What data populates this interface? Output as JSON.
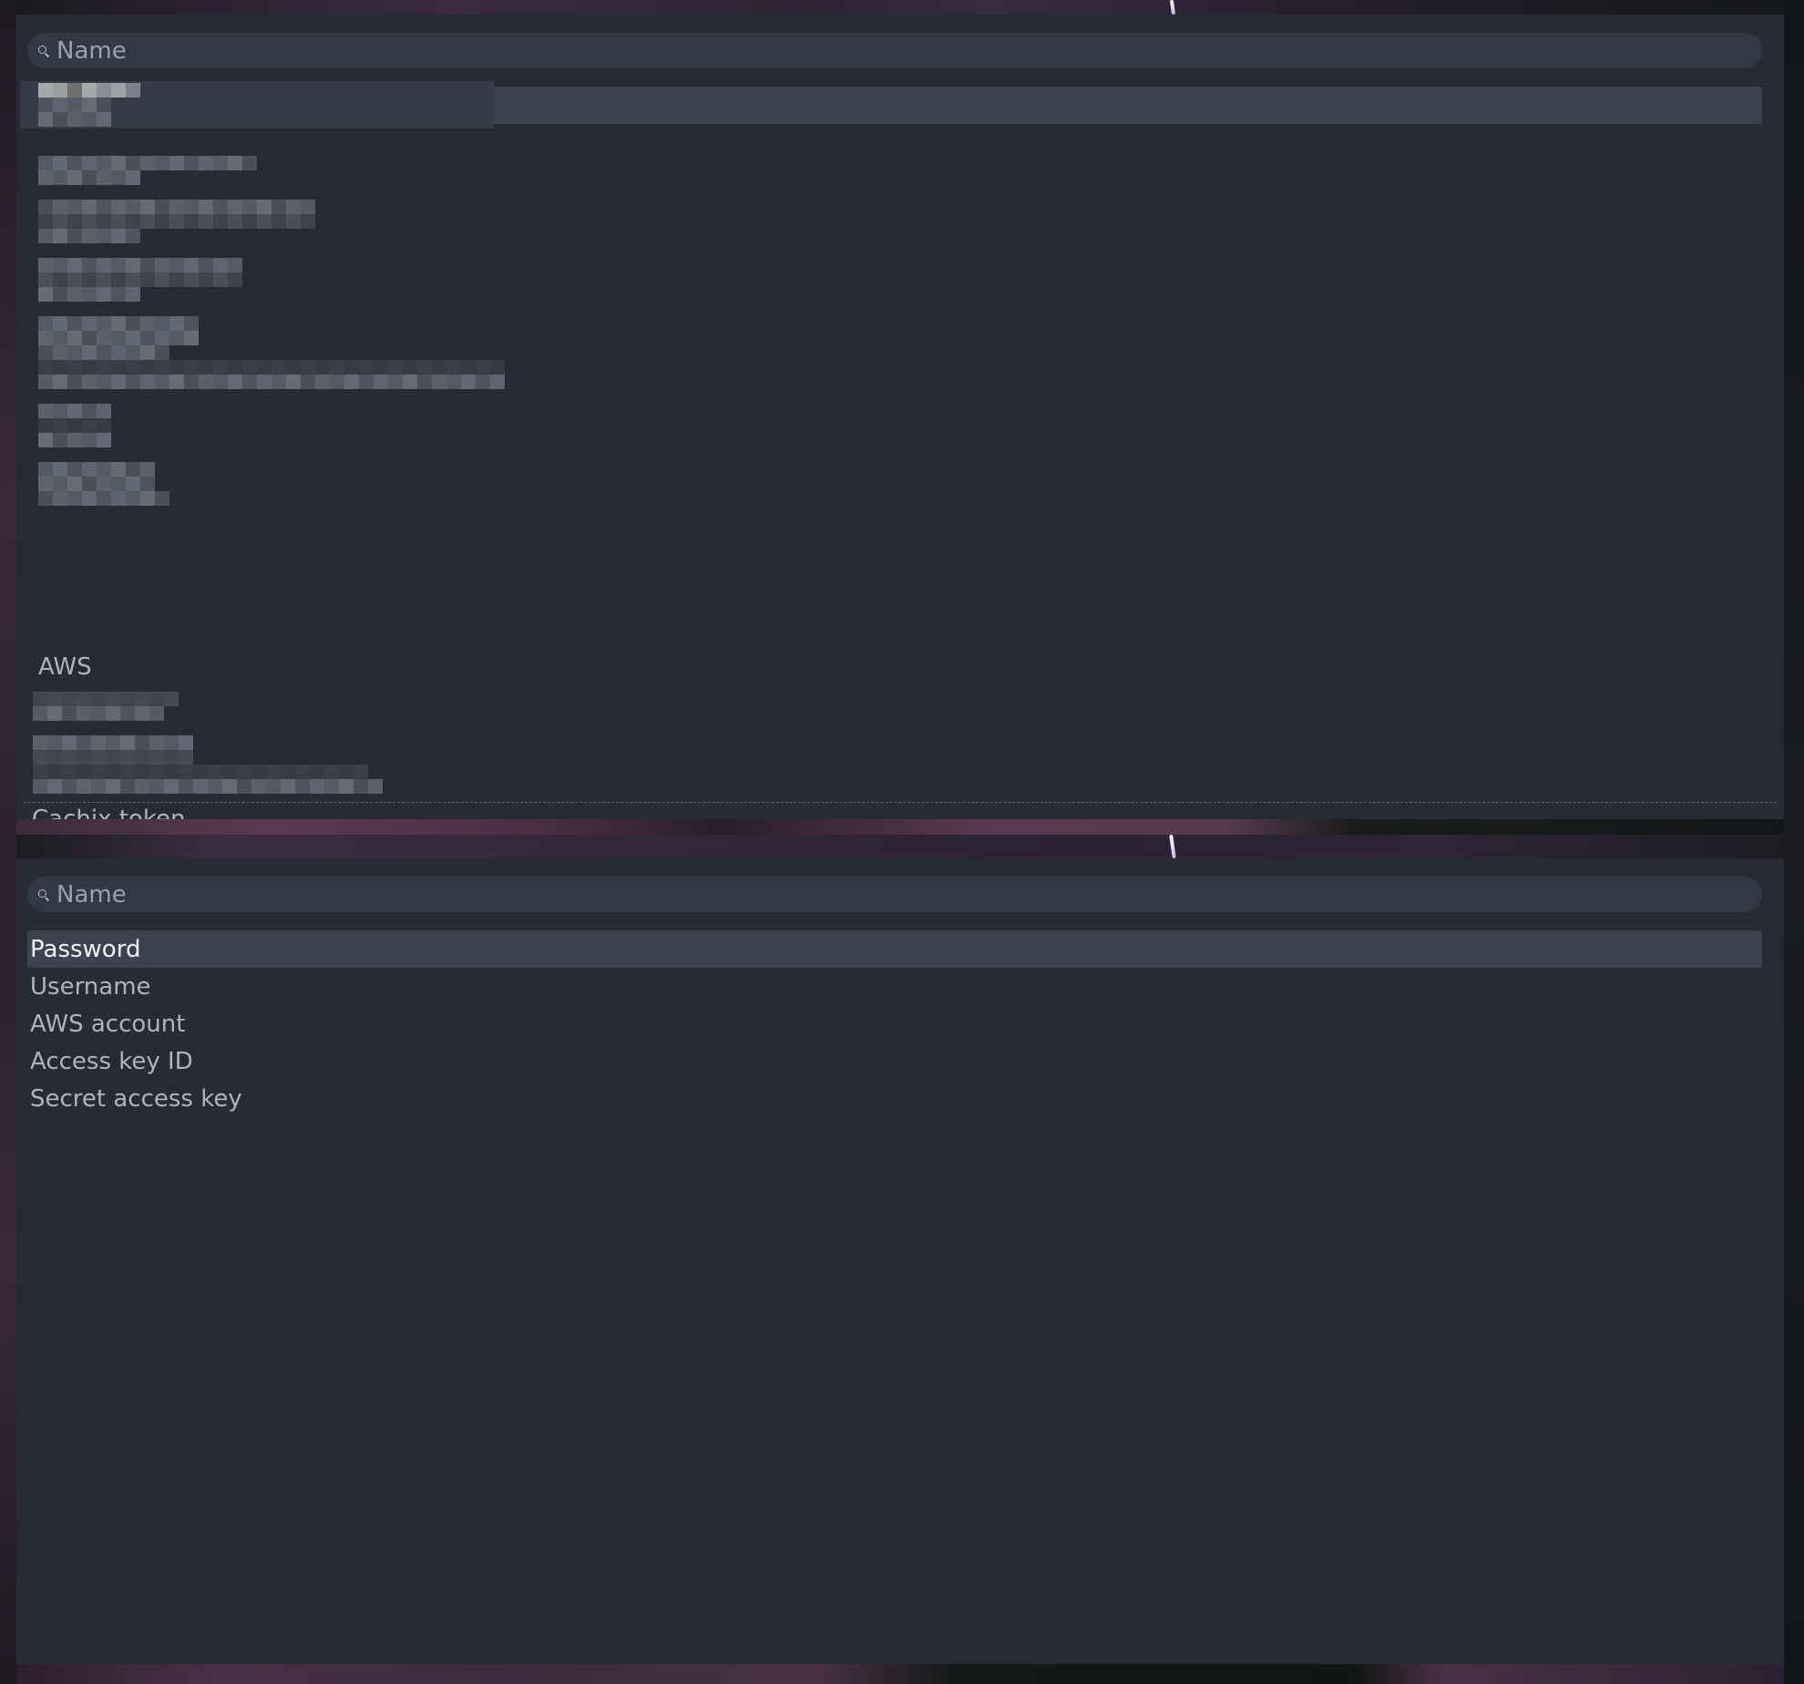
{
  "panels": [
    {
      "search": {
        "placeholder": "Name",
        "value": "",
        "icon": "search-icon"
      },
      "items": [
        {
          "label": "[redacted]",
          "redacted": true,
          "selected": true
        },
        {
          "label": "[redacted]",
          "redacted": true
        },
        {
          "label": "[redacted]",
          "redacted": true
        },
        {
          "label": "[redacted]",
          "redacted": true
        },
        {
          "label": "[redacted]",
          "redacted": true
        },
        {
          "label": "[redacted]",
          "redacted": true
        },
        {
          "label": "[redacted]",
          "redacted": true
        },
        {
          "label": "[redacted]",
          "redacted": true
        },
        {
          "label": "AWS",
          "redacted": false
        },
        {
          "label": "[redacted]",
          "redacted": true
        },
        {
          "label": "[redacted]",
          "redacted": true
        },
        {
          "label": "Cachix token",
          "redacted": false,
          "clipped": true
        }
      ]
    },
    {
      "search": {
        "placeholder": "Name",
        "value": "",
        "icon": "search-icon"
      },
      "items": [
        {
          "label": "Password",
          "selected": true
        },
        {
          "label": "Username"
        },
        {
          "label": "AWS account"
        },
        {
          "label": "Access key ID"
        },
        {
          "label": "Secret access key"
        }
      ]
    }
  ],
  "colors": {
    "panel_bg": "#272b34",
    "search_bg": "#333944",
    "selected_bg": "#3b4250",
    "text": "#aeb4bf",
    "selected_text": "#f2f4f7"
  }
}
